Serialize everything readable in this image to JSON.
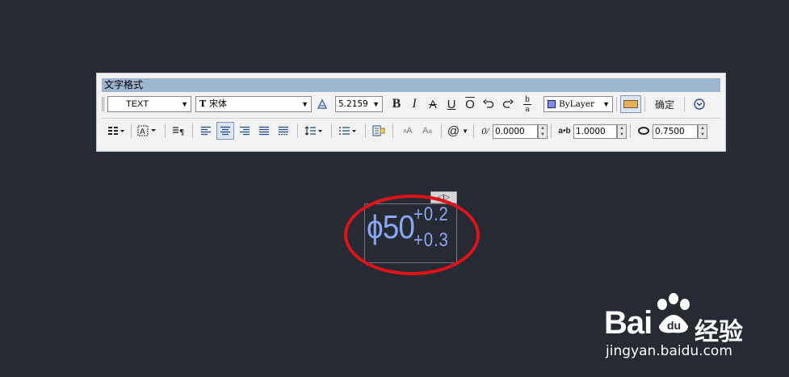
{
  "toolbar": {
    "title": "文字格式",
    "style_value": "TEXT",
    "font_value": "宋体",
    "font_prefix": "T",
    "height_value": "5.2159",
    "bold_label": "B",
    "italic_label": "I",
    "strike_label": "A",
    "underline_label": "U",
    "overline_label": "O",
    "stack_label": "b",
    "color_value": "ByLayer",
    "ok_label": "确定",
    "oblique_value": "0.0000",
    "tracking_label": "a•b",
    "tracking_value": "1.0000",
    "width_value": "0.7500",
    "at_label": "@",
    "oblique_label": "0/"
  },
  "mtext": {
    "main": "ϕ50",
    "upper": "+0.2",
    "lower": "+0.3"
  },
  "watermark": {
    "brand": "Bai",
    "brand2": "经验",
    "url": "jingyan.baidu.com"
  },
  "colors": {
    "background": "#252a33",
    "text": "#8ba7f2",
    "highlight": "#e0131b"
  }
}
